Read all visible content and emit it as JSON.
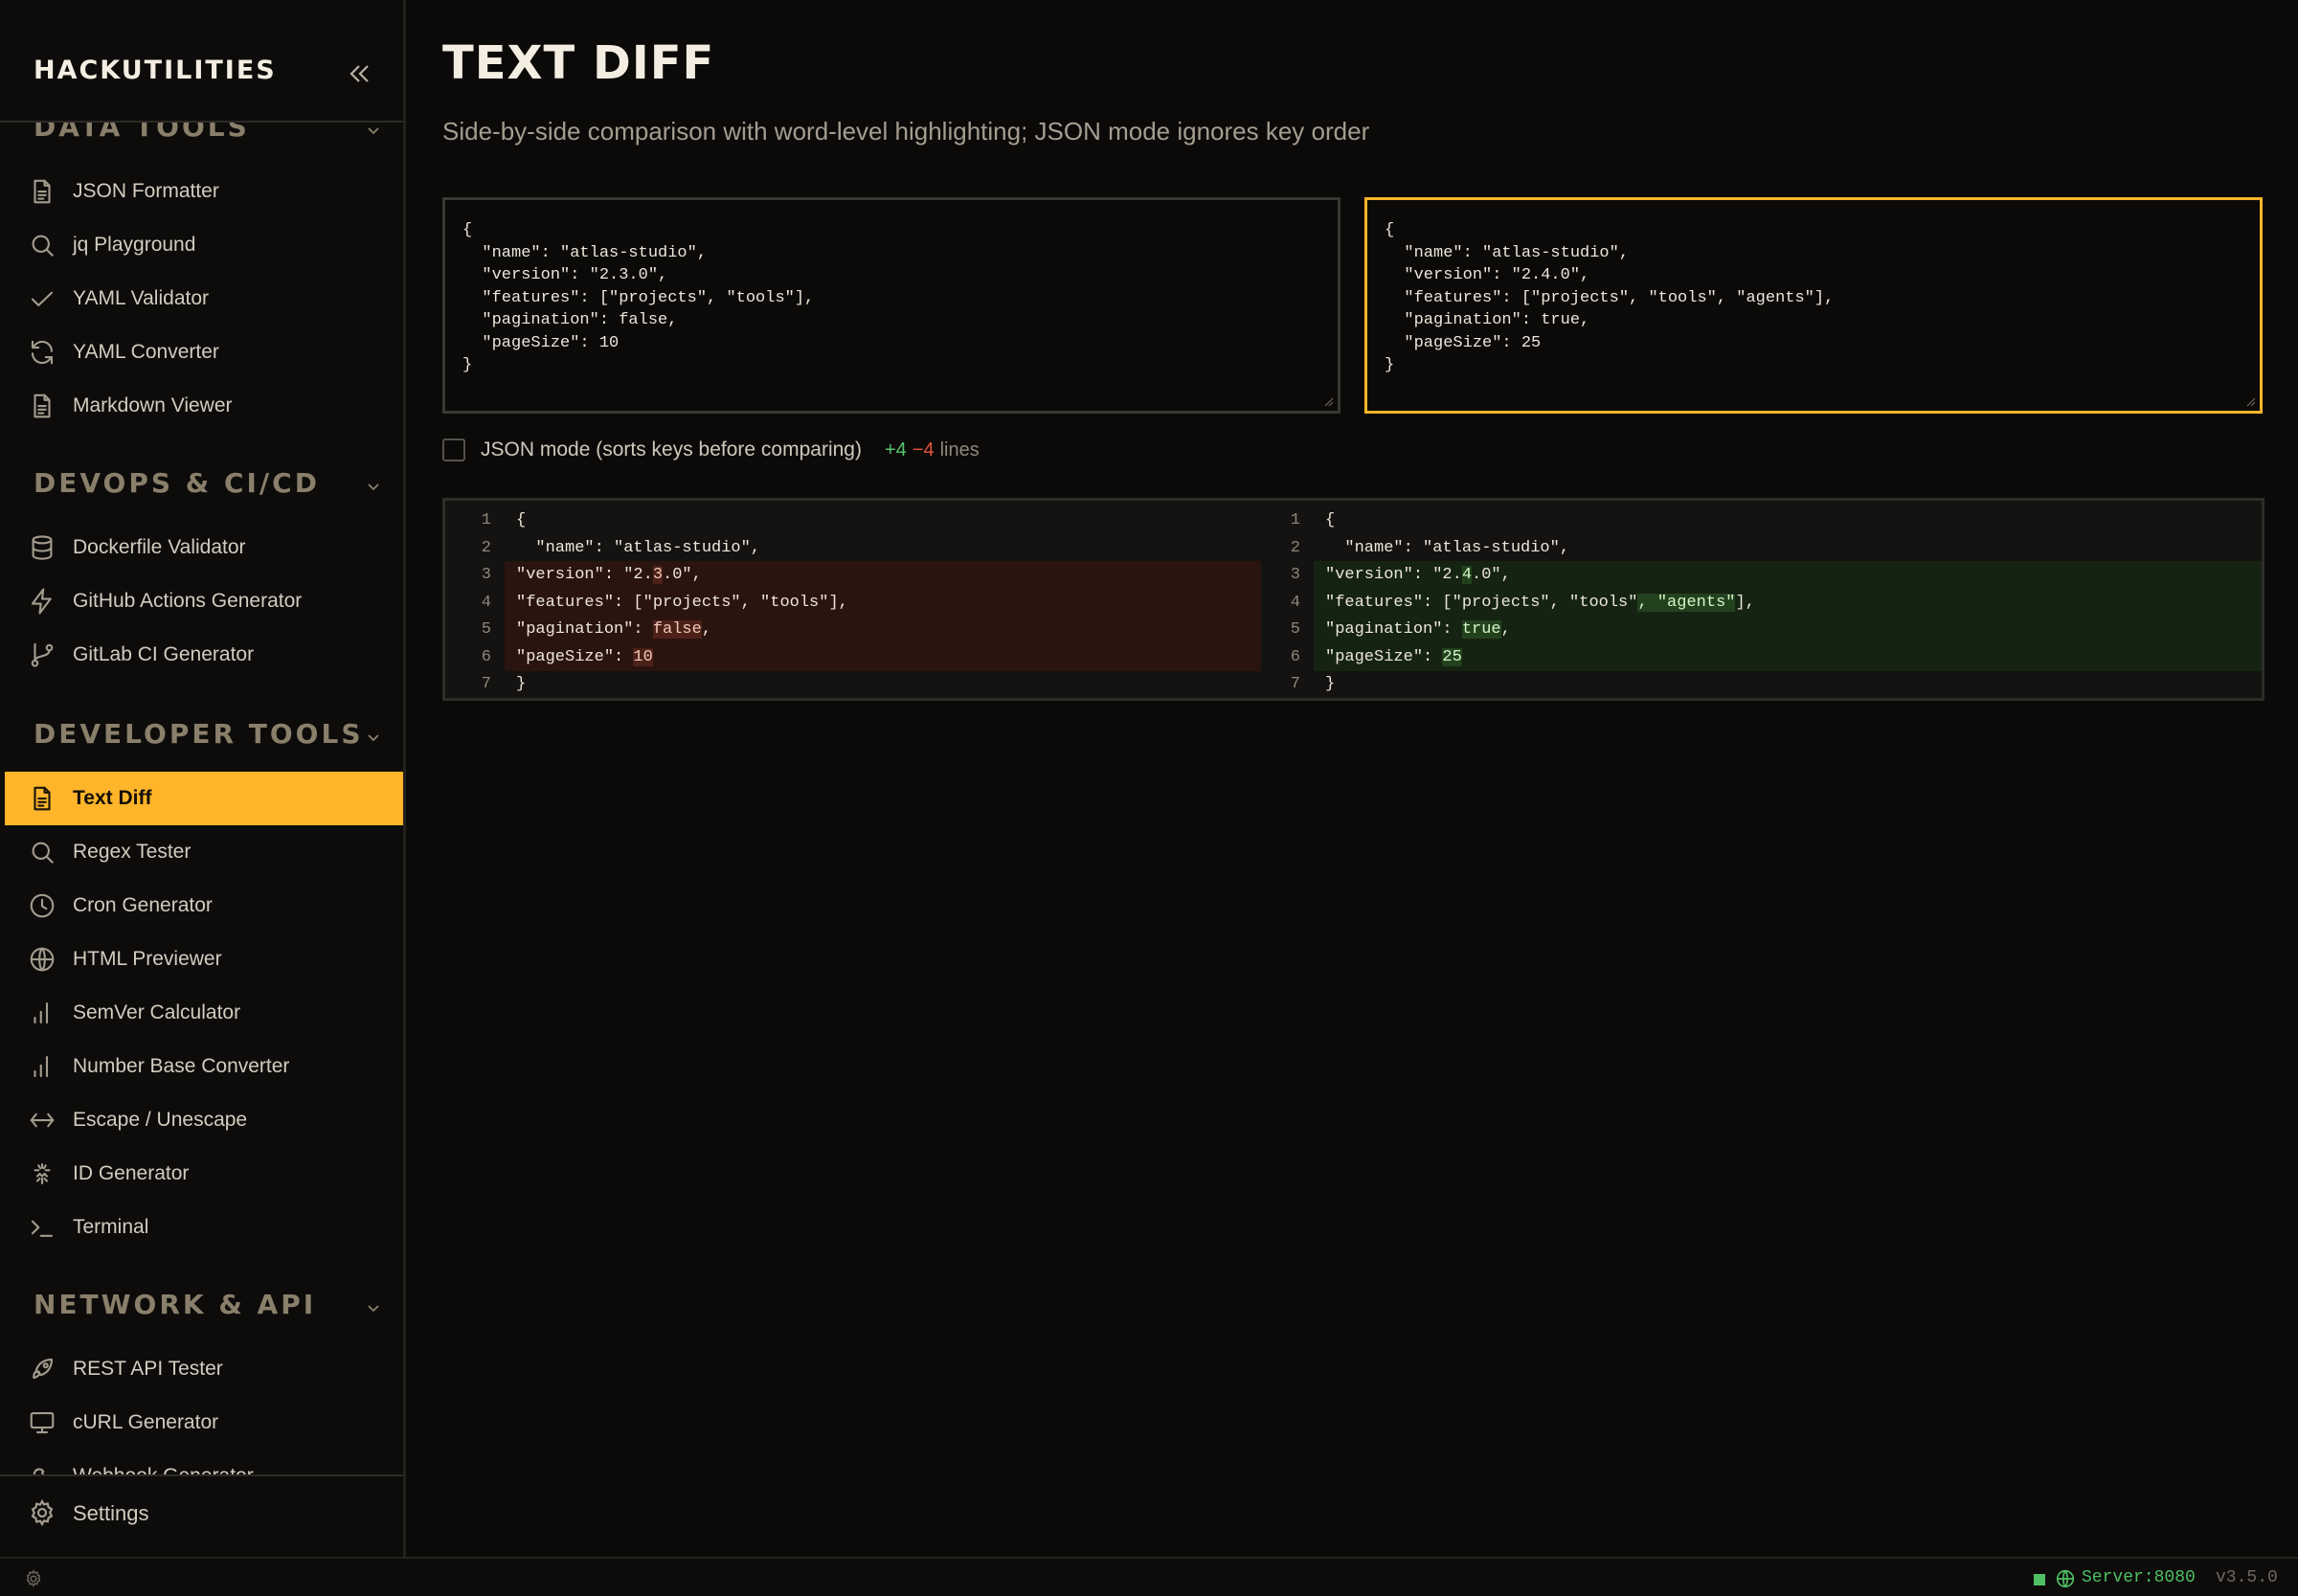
{
  "brand": {
    "title": "HACKUTILITIES"
  },
  "sidebar": {
    "sections": [
      {
        "title": "DATA TOOLS",
        "items": [
          {
            "label": "JSON Formatter",
            "icon": "file-icon"
          },
          {
            "label": "jq Playground",
            "icon": "search-icon"
          },
          {
            "label": "YAML Validator",
            "icon": "check-icon"
          },
          {
            "label": "YAML Converter",
            "icon": "refresh-icon"
          },
          {
            "label": "Markdown Viewer",
            "icon": "file-icon"
          }
        ]
      },
      {
        "title": "DEVOPS & CI/CD",
        "items": [
          {
            "label": "Dockerfile Validator",
            "icon": "database-icon"
          },
          {
            "label": "GitHub Actions Generator",
            "icon": "bolt-icon"
          },
          {
            "label": "GitLab CI Generator",
            "icon": "git-branch-icon"
          }
        ]
      },
      {
        "title": "DEVELOPER TOOLS",
        "items": [
          {
            "label": "Text Diff",
            "icon": "file-icon",
            "active": true
          },
          {
            "label": "Regex Tester",
            "icon": "search-icon"
          },
          {
            "label": "Cron Generator",
            "icon": "clock-icon"
          },
          {
            "label": "HTML Previewer",
            "icon": "globe-icon"
          },
          {
            "label": "SemVer Calculator",
            "icon": "bar-chart-icon"
          },
          {
            "label": "Number Base Converter",
            "icon": "bar-chart-icon"
          },
          {
            "label": "Escape / Unescape",
            "icon": "arrows-horizontal-icon"
          },
          {
            "label": "ID Generator",
            "icon": "fingerprint-icon"
          },
          {
            "label": "Terminal",
            "icon": "terminal-icon"
          }
        ]
      },
      {
        "title": "NETWORK & API",
        "items": [
          {
            "label": "REST API Tester",
            "icon": "rocket-icon"
          },
          {
            "label": "cURL Generator",
            "icon": "monitor-icon"
          },
          {
            "label": "Webhook Generator",
            "icon": "webhook-icon"
          }
        ]
      }
    ],
    "settings_label": "Settings"
  },
  "page": {
    "title": "TEXT DIFF",
    "subtitle": "Side-by-side comparison with word-level highlighting; JSON mode ignores key order"
  },
  "inputs": {
    "left": "{\n  \"name\": \"atlas-studio\",\n  \"version\": \"2.3.0\",\n  \"features\": [\"projects\", \"tools\"],\n  \"pagination\": false,\n  \"pageSize\": 10\n}",
    "right": "{\n  \"name\": \"atlas-studio\",\n  \"version\": \"2.4.0\",\n  \"features\": [\"projects\", \"tools\", \"agents\"],\n  \"pagination\": true,\n  \"pageSize\": 25\n}"
  },
  "options": {
    "json_mode_label": "JSON mode (sorts keys before comparing)",
    "json_mode_checked": false,
    "added": "+4",
    "removed": "−4",
    "lines_word": "lines"
  },
  "diff": {
    "left": [
      {
        "n": "1",
        "type": "same",
        "parts": [
          [
            "{",
            ""
          ]
        ]
      },
      {
        "n": "2",
        "type": "same",
        "parts": [
          [
            "  \"name\": \"atlas-studio\",",
            ""
          ]
        ]
      },
      {
        "n": "3",
        "type": "del",
        "parts": [
          [
            "\"version\": \"2.",
            ""
          ],
          [
            "3",
            "hl"
          ],
          [
            ".0\",",
            ""
          ]
        ]
      },
      {
        "n": "4",
        "type": "del",
        "parts": [
          [
            "\"features\": [\"projects\", \"tools\"],",
            ""
          ]
        ]
      },
      {
        "n": "5",
        "type": "del",
        "parts": [
          [
            "\"pagination\": ",
            ""
          ],
          [
            "false",
            "hl"
          ],
          [
            ",",
            ""
          ]
        ]
      },
      {
        "n": "6",
        "type": "del",
        "parts": [
          [
            "\"pageSize\": ",
            ""
          ],
          [
            "10",
            "hl"
          ]
        ]
      },
      {
        "n": "7",
        "type": "same",
        "parts": [
          [
            "}",
            ""
          ]
        ]
      }
    ],
    "right": [
      {
        "n": "1",
        "type": "same",
        "parts": [
          [
            "{",
            ""
          ]
        ]
      },
      {
        "n": "2",
        "type": "same",
        "parts": [
          [
            "  \"name\": \"atlas-studio\",",
            ""
          ]
        ]
      },
      {
        "n": "3",
        "type": "ins",
        "parts": [
          [
            "\"version\": \"2.",
            ""
          ],
          [
            "4",
            "hl"
          ],
          [
            ".0\",",
            ""
          ]
        ]
      },
      {
        "n": "4",
        "type": "ins",
        "parts": [
          [
            "\"features\": [\"projects\", \"tools\"",
            ""
          ],
          [
            ", \"agents\"",
            "hl"
          ],
          [
            "],",
            ""
          ]
        ]
      },
      {
        "n": "5",
        "type": "ins",
        "parts": [
          [
            "\"pagination\": ",
            ""
          ],
          [
            "true",
            "hl"
          ],
          [
            ",",
            ""
          ]
        ]
      },
      {
        "n": "6",
        "type": "ins",
        "parts": [
          [
            "\"pageSize\": ",
            ""
          ],
          [
            "25",
            "hl"
          ]
        ]
      },
      {
        "n": "7",
        "type": "same",
        "parts": [
          [
            "}",
            ""
          ]
        ]
      }
    ]
  },
  "status": {
    "server": "Server:8080",
    "version": "v3.5.0"
  },
  "colors": {
    "accent": "#ffb52a",
    "added": "#56c46c",
    "removed": "#e5533d",
    "background": "#0b0a09"
  }
}
